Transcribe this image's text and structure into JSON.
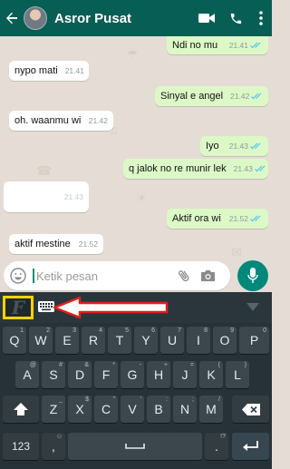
{
  "header": {
    "contact_name": "Asror Pusat",
    "bg_color": "#075e54",
    "icons": [
      "back-arrow-icon",
      "avatar",
      "video-call-icon",
      "phone-icon",
      "more-vert-icon"
    ]
  },
  "messages": [
    {
      "dir": "out",
      "text": "Ndi no mu",
      "time": "21.41",
      "read": true
    },
    {
      "dir": "in",
      "text": "nypo mati",
      "time": "21.41"
    },
    {
      "dir": "out",
      "text": "Sinyal e angel",
      "time": "21.42",
      "read": true
    },
    {
      "dir": "in",
      "text": "oh.   waanmu wi",
      "time": "21.42"
    },
    {
      "dir": "out",
      "text": "Iyo",
      "time": "21.43",
      "read": true
    },
    {
      "dir": "out",
      "text": "q jalok no re munir lek",
      "time": "21.43",
      "read": true
    },
    {
      "dir": "in",
      "text": "",
      "time": "21.43",
      "blurred": true
    },
    {
      "dir": "out",
      "text": "Aktif ora wi",
      "time": "21.52",
      "read": true
    },
    {
      "dir": "in",
      "text": "aktif mestine",
      "time": "21.52"
    }
  ],
  "input": {
    "placeholder": "Ketik pesan",
    "value": ""
  },
  "keyboard": {
    "row1": [
      {
        "k": "Q",
        "h": "1"
      },
      {
        "k": "W",
        "h": "2"
      },
      {
        "k": "E",
        "h": "3"
      },
      {
        "k": "R",
        "h": "4"
      },
      {
        "k": "T",
        "h": "5"
      },
      {
        "k": "Y",
        "h": "6"
      },
      {
        "k": "U",
        "h": "7"
      },
      {
        "k": "I",
        "h": "8"
      },
      {
        "k": "O",
        "h": "9"
      },
      {
        "k": "P",
        "h": "0"
      }
    ],
    "row2": [
      {
        "k": "A",
        "h": "@"
      },
      {
        "k": "S",
        "h": "#"
      },
      {
        "k": "D",
        "h": "&"
      },
      {
        "k": "F",
        "h": "*"
      },
      {
        "k": "G",
        "h": "-"
      },
      {
        "k": "H",
        "h": "+"
      },
      {
        "k": "J",
        "h": "="
      },
      {
        "k": "K",
        "h": "("
      },
      {
        "k": "L",
        "h": ")"
      }
    ],
    "row3": [
      {
        "k": "Z",
        "h": "_"
      },
      {
        "k": "X",
        "h": "$"
      },
      {
        "k": "C",
        "h": "\""
      },
      {
        "k": "V",
        "h": "'"
      },
      {
        "k": "B",
        "h": ":"
      },
      {
        "k": "N",
        "h": ";"
      },
      {
        "k": "M",
        "h": "/"
      }
    ],
    "numbers_label": "123",
    "comma": ",",
    "comma_hint": "☺",
    "period": ".",
    "period_hint": "!?",
    "fancy_font_label": "F",
    "highlight_color": "#ffd400",
    "annotation_arrow_color": "#e0201b"
  }
}
